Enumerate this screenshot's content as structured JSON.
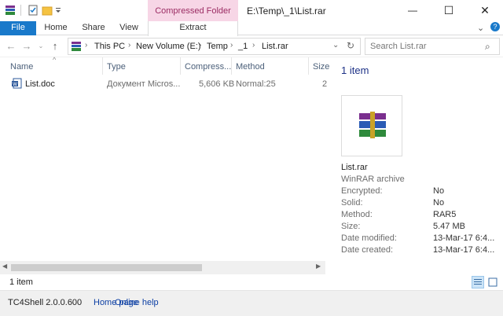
{
  "titlebar": {
    "context_tab": "Compressed Folder Tools",
    "title": "E:\\Temp\\_1\\List.rar",
    "minimize": "—",
    "maximize": "☐",
    "close": "✕"
  },
  "ribbon": {
    "tabs": [
      "File",
      "Home",
      "Share",
      "View",
      "Extract"
    ]
  },
  "address": {
    "crumbs": [
      "This PC",
      "New Volume (E:)",
      "Temp",
      "_1",
      "List.rar"
    ],
    "search_placeholder": "Search List.rar"
  },
  "columns": [
    "Name",
    "Type",
    "Compress...",
    "Method",
    "Size"
  ],
  "file": {
    "name": "List.doc",
    "type": "Документ Micros...",
    "compressed": "5,606 KB",
    "method": "Normal:25",
    "size": "2"
  },
  "details": {
    "item_count": "1 item",
    "filename": "List.rar",
    "filetype": "WinRAR archive",
    "rows": [
      {
        "label": "Encrypted:",
        "value": "No"
      },
      {
        "label": "Solid:",
        "value": "No"
      },
      {
        "label": "Method:",
        "value": "RAR5"
      },
      {
        "label": "Size:",
        "value": "5.47 MB"
      },
      {
        "label": "Date modified:",
        "value": "13-Mar-17 6:4..."
      },
      {
        "label": "Date created:",
        "value": "13-Mar-17 6:4..."
      }
    ]
  },
  "status": {
    "item_count": "1 item"
  },
  "footer": {
    "product": "TC4Shell 2.0.0.600",
    "home_link": "Home page",
    "online_link": "Online help"
  },
  "colors": {
    "accent": "#1979ca",
    "context_bg": "#f7d6e6",
    "context_text": "#9b2c63"
  }
}
